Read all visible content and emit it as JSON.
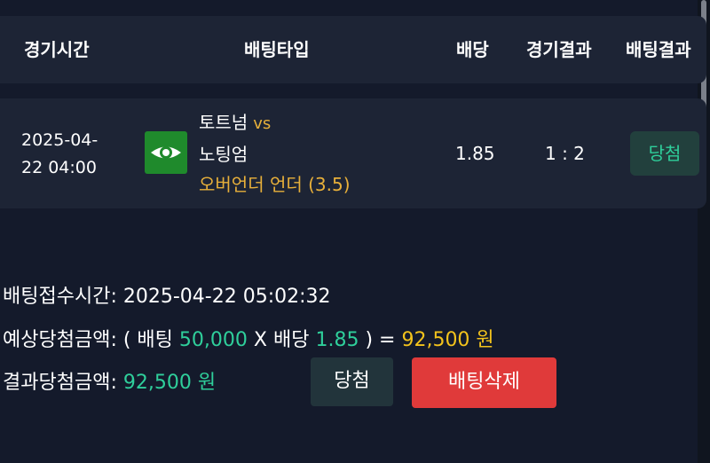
{
  "header": {
    "time": "경기시간",
    "bet_type": "배팅타입",
    "odds": "배당",
    "game_result": "경기결과",
    "bet_result": "배팅결과"
  },
  "row": {
    "date_line1": "2025-04-",
    "date_line2": "22 04:00",
    "league_icon": "eye-icon",
    "home_team": "토트넘",
    "vs": "vs",
    "away_team": "노팅엄",
    "bet_line": "오버언더 언더 (3.5)",
    "odds": "1.85",
    "score": "1 : 2",
    "result": "당첨"
  },
  "summary": {
    "received_label": "배팅접수시간:",
    "received_value": "2025-04-22 05:02:32",
    "expected_label": "예상당첨금액:",
    "open_paren": "( 배팅",
    "bet_amount": "50,000",
    "times": "X 배당",
    "odds": "1.85",
    "close_paren": ") =",
    "expected_total": "92,500 원",
    "result_label": "결과당첨금액:",
    "result_value": "92,500 원",
    "win_button": "당첨",
    "delete_button": "배팅삭제"
  },
  "colors": {
    "background": "#141a2b",
    "card": "#1d2435",
    "win_green": "#2fcf9b",
    "gold": "#f3c31c",
    "delete_red": "#e03a3a"
  }
}
